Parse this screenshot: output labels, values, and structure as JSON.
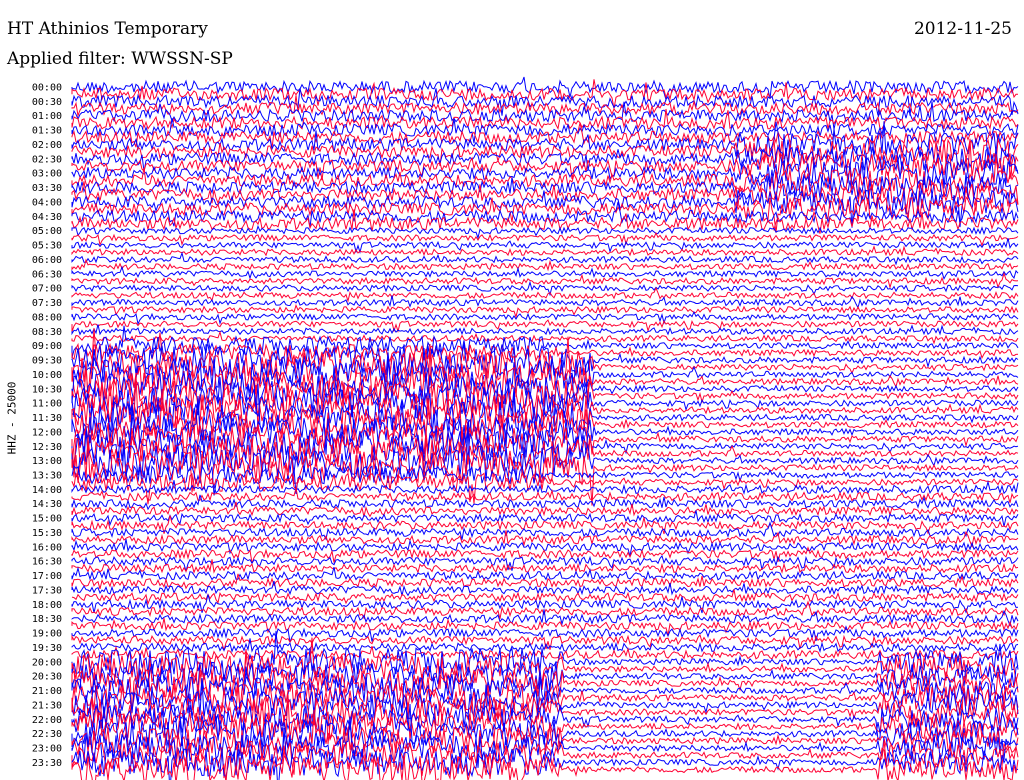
{
  "header": {
    "station": "HT Athinios Temporary",
    "date": "2012-11-25",
    "filter": "Applied filter: WWSSN-SP"
  },
  "chart_data": {
    "type": "line",
    "title": "HT Athinios Temporary",
    "date": "2012-11-25",
    "filter": "WWSSN-SP",
    "ylabel": "HHZ - 25000",
    "xlabel": "",
    "row_labels": [
      "00:00",
      "00:30",
      "01:00",
      "01:30",
      "02:00",
      "02:30",
      "03:00",
      "03:30",
      "04:00",
      "04:30",
      "05:00",
      "05:30",
      "06:00",
      "06:30",
      "07:00",
      "07:30",
      "08:00",
      "08:30",
      "09:00",
      "09:30",
      "10:00",
      "10:30",
      "11:00",
      "11:30",
      "12:00",
      "12:30",
      "13:00",
      "13:30",
      "14:00",
      "14:30",
      "15:00",
      "15:30",
      "16:00",
      "16:30",
      "17:00",
      "17:30",
      "18:00",
      "18:30",
      "19:00",
      "19:30",
      "20:00",
      "20:30",
      "21:00",
      "21:30",
      "22:00",
      "22:30",
      "23:00",
      "23:30"
    ],
    "series_colors": [
      "#0000ff",
      "#ff0033"
    ],
    "color_pattern": "alternating blue/red traces, one per 15-minute line",
    "grid": false
  }
}
